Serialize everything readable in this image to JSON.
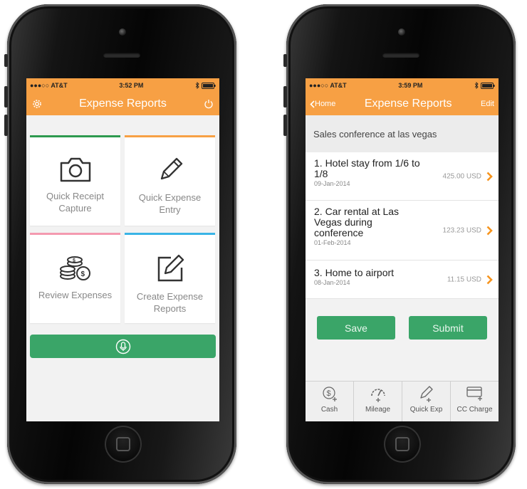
{
  "colors": {
    "accent": "#f7a044",
    "green": "#3aa568",
    "chevron": "#f7941d"
  },
  "left_phone": {
    "status": {
      "carrier": "●●●○○ AT&T",
      "time": "3:52 PM",
      "icons": [
        "wifi-icon",
        "bluetooth-icon",
        "battery-icon"
      ]
    },
    "header": {
      "title": "Expense Reports",
      "left_icon": "gear-icon",
      "right_icon": "power-icon"
    },
    "tiles": [
      {
        "label": "Quick Receipt Capture",
        "icon": "camera-icon",
        "color": "#2e9a4f"
      },
      {
        "label": "Quick Expense Entry",
        "icon": "pencil-icon",
        "color": "#f7a044"
      },
      {
        "label": "Review Expenses",
        "icon": "coins-icon",
        "color": "#f49ab0"
      },
      {
        "label": "Create Expense Reports",
        "icon": "edit-icon",
        "color": "#3ab4e6"
      }
    ],
    "mic_icon": "microphone-icon"
  },
  "right_phone": {
    "status": {
      "carrier": "●●●○○ AT&T",
      "time": "3:59 PM",
      "icons": [
        "wifi-icon",
        "bluetooth-icon",
        "battery-icon"
      ]
    },
    "header": {
      "back_label": "Home",
      "title": "Expense Reports",
      "edit_label": "Edit"
    },
    "report_name": "Sales conference at las vegas",
    "items": [
      {
        "title": "1. Hotel stay from 1/6 to 1/8",
        "date": "09-Jan-2014",
        "amount": "425.00 USD"
      },
      {
        "title": "2. Car rental at Las Vegas during conference",
        "date": "01-Feb-2014",
        "amount": "123.23 USD"
      },
      {
        "title": "3. Home to airport",
        "date": "08-Jan-2014",
        "amount": "11.15 USD"
      }
    ],
    "buttons": {
      "save": "Save",
      "submit": "Submit"
    },
    "toolbar": [
      {
        "label": "Cash",
        "icon": "cash-add-icon"
      },
      {
        "label": "Mileage",
        "icon": "speedometer-add-icon"
      },
      {
        "label": "Quick Exp",
        "icon": "pencil-add-icon"
      },
      {
        "label": "CC Charge",
        "icon": "credit-card-add-icon"
      }
    ]
  }
}
